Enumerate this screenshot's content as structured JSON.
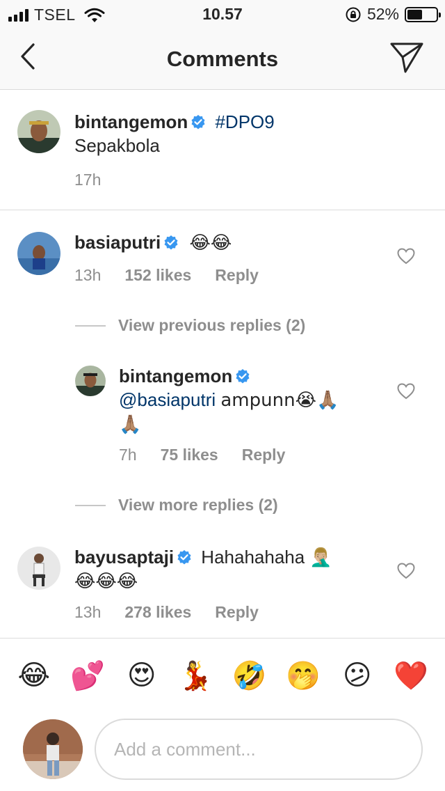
{
  "status_bar": {
    "carrier": "TSEL",
    "time": "10.57",
    "battery_percent": "52%",
    "battery_level": 0.52,
    "signal_icon": "signal-bars-icon",
    "wifi_icon": "wifi-icon",
    "rotation_lock_icon": "rotation-lock-icon"
  },
  "header": {
    "title": "Comments",
    "back_icon": "chevron-left-icon",
    "share_icon": "paper-plane-icon"
  },
  "caption": {
    "username": "bintangemon",
    "verified": true,
    "hashtag": "#DPO9",
    "text": "Sepakbola",
    "time": "17h"
  },
  "comments": [
    {
      "username": "basiaputri",
      "verified": true,
      "text": "😂😂",
      "time": "13h",
      "likes": "152 likes",
      "reply_label": "Reply",
      "view_previous": "View previous replies (2)",
      "replies": [
        {
          "username": "bintangemon",
          "verified": true,
          "mention": "@basiaputri",
          "text": "ampunn😭🙏🏽",
          "text_line2": "🙏🏽",
          "time": "7h",
          "likes": "75 likes",
          "reply_label": "Reply"
        }
      ],
      "view_more": "View more replies (2)"
    },
    {
      "username": "bayusaptaji",
      "verified": true,
      "text": "Hahahahaha 🤦🏼‍♂️",
      "text_line2": "😂😂😂",
      "time": "13h",
      "likes": "278 likes",
      "reply_label": "Reply"
    }
  ],
  "quick_emojis": [
    "😂",
    "💕",
    "😍",
    "💃",
    "🤣",
    "🤭",
    "😕",
    "❤️"
  ],
  "composer": {
    "placeholder": "Add a comment..."
  },
  "colors": {
    "link": "#003569",
    "verified": "#3897f0",
    "secondary_text": "#8e8e8e",
    "divider": "#dbdbdb"
  }
}
